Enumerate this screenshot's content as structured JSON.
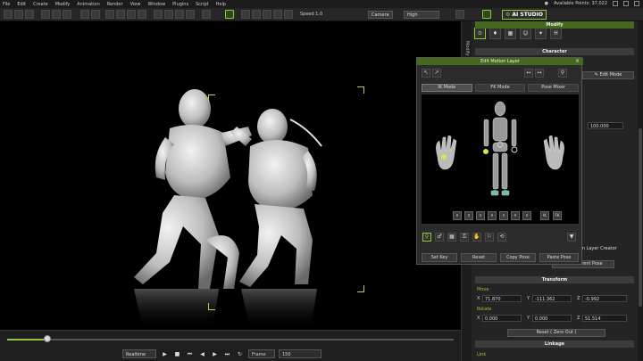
{
  "menu": {
    "items": [
      "File",
      "Edit",
      "Create",
      "Modify",
      "Animation",
      "Render",
      "View",
      "Window",
      "Plugins",
      "Script",
      "Help"
    ],
    "points_label": "Available Points: 37,022"
  },
  "toolbar": {
    "speed": "Speed 1.0",
    "camera": "Camera",
    "quality": "High",
    "ai_studio": "AI STUDIO"
  },
  "sidetab": {
    "label": "Modify"
  },
  "panel": {
    "title": "Modify",
    "character": "Character",
    "edit_mode": "Edit Mode",
    "field_value": "100.000",
    "motion_layer_label": "Motion Layer Creator",
    "reset_pose": "Edit Current Pose",
    "transform": "Transform",
    "move": "Move",
    "rotate": "Rotate",
    "move_x": "71.870",
    "move_y": "-111.362",
    "move_z": "-0.992",
    "rot_x": "0.000",
    "rot_y": "0.000",
    "rot_z": "51.514",
    "reset_btn": "Reset ( Zero Out )",
    "linkage": "Linkage",
    "link": "Link"
  },
  "dialog": {
    "title": "Edit Motion Layer",
    "modes": [
      "IK Mode",
      "FK Mode",
      "Pose Mixer"
    ],
    "buttons": [
      "Set Key",
      "Reset",
      "Copy Pose",
      "Paste Pose"
    ],
    "ik_label": "IK",
    "fk_label": "FK"
  },
  "timeline": {
    "realtime": "Realtime",
    "frames": "Frame",
    "frame_value": "150",
    "progress": 0.09
  },
  "colors": {
    "accent": "#8fc63f",
    "header": "#45691f"
  }
}
